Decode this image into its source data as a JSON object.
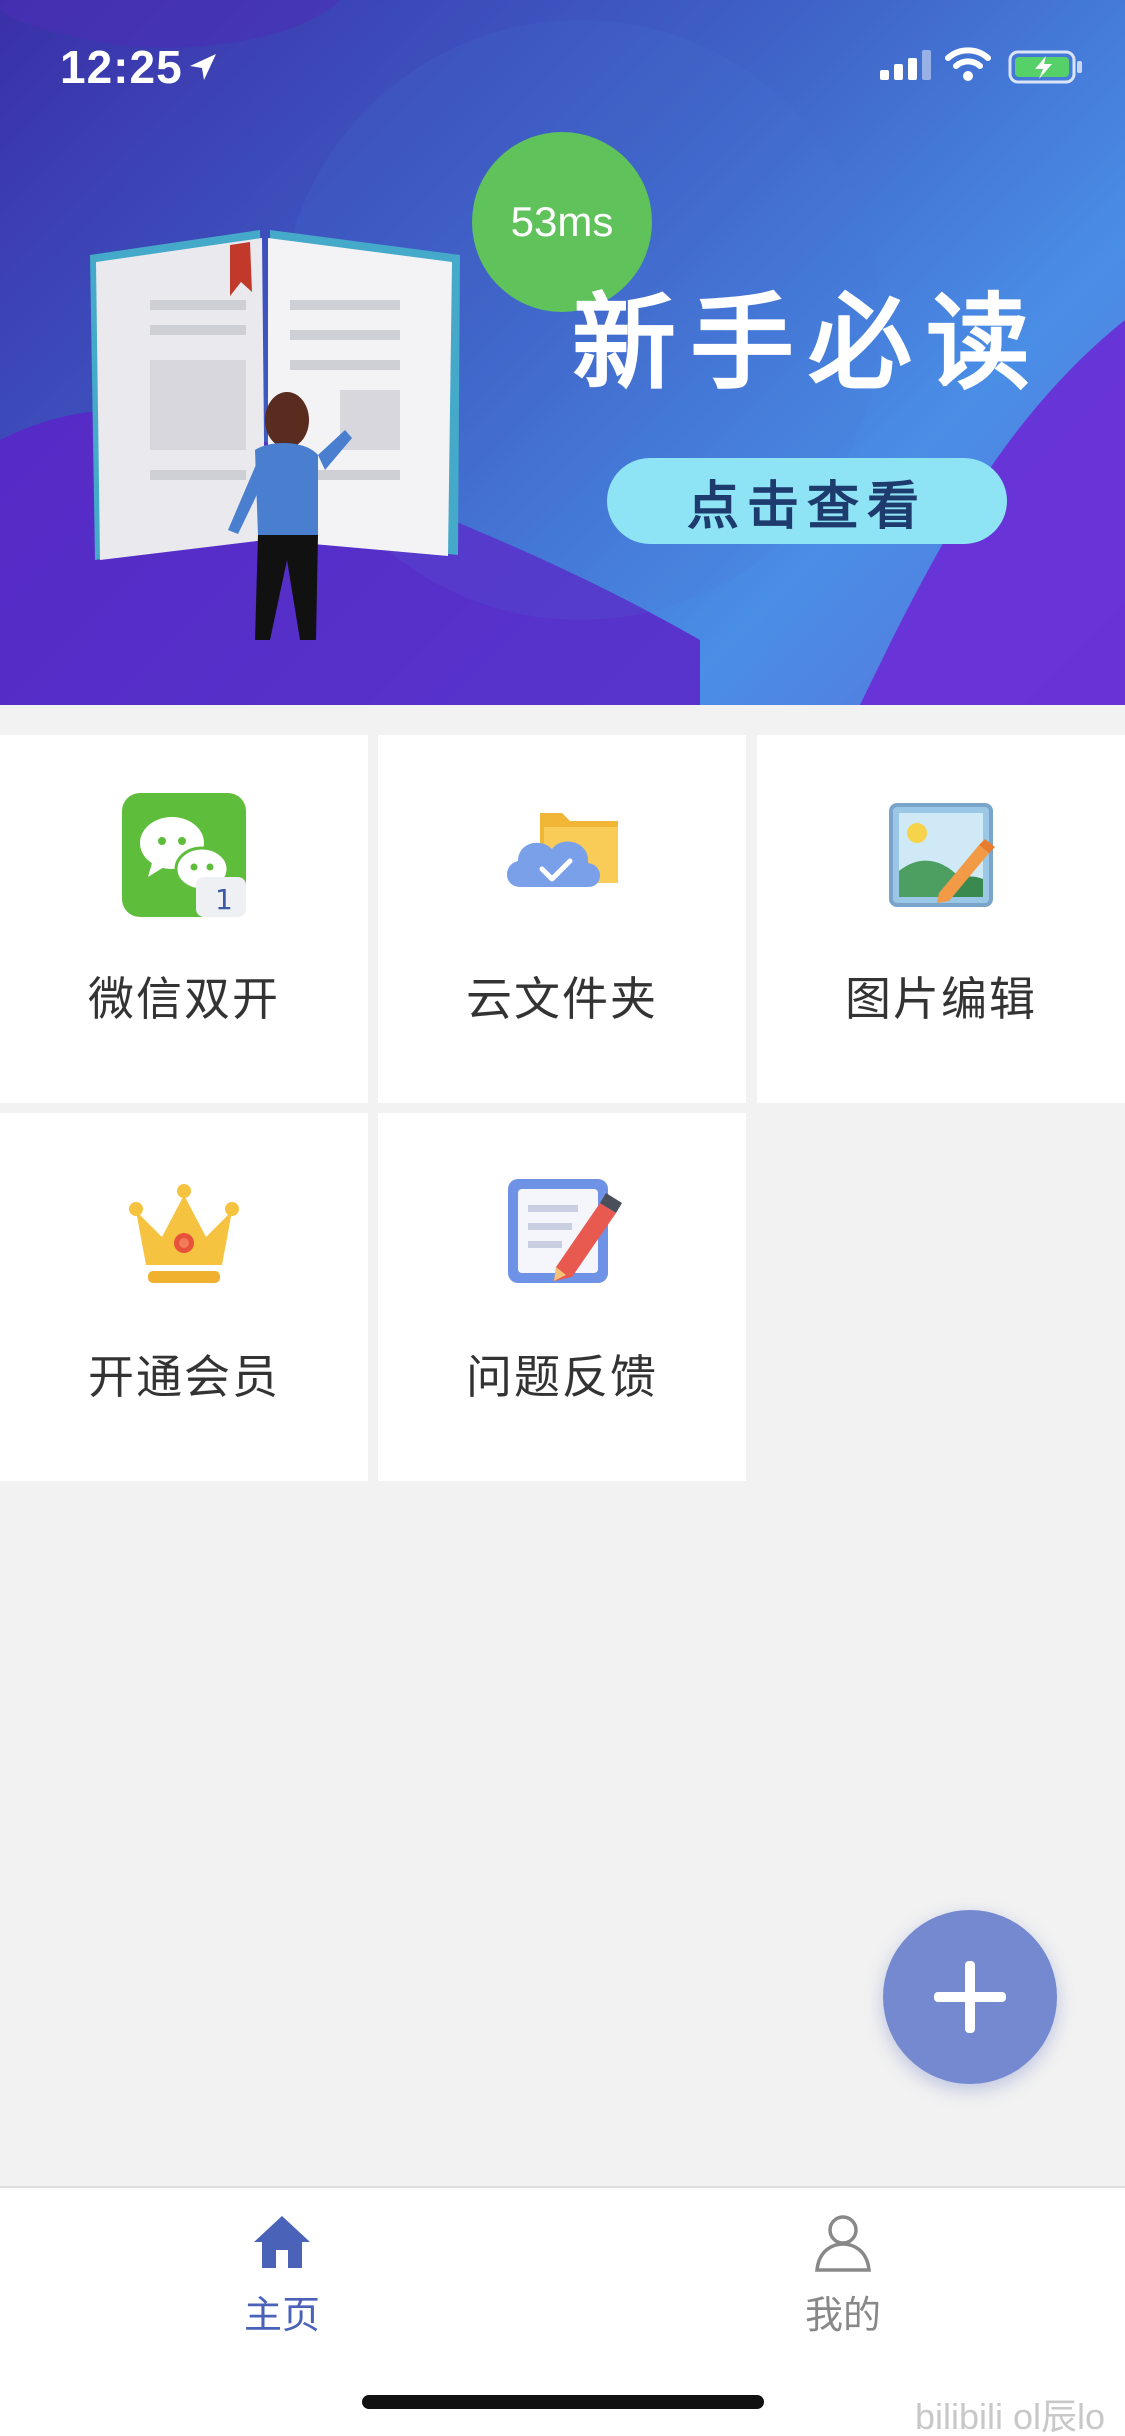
{
  "status_bar": {
    "time": "12:25",
    "icons": [
      "location-arrow-icon",
      "signal-icon",
      "wifi-icon",
      "battery-charging-icon"
    ]
  },
  "banner": {
    "latency": "53ms",
    "title": "新手必读",
    "button_label": "点击查看",
    "colors": {
      "bg_start": "#3a2fa8",
      "bg_end": "#4a8ee6",
      "button": "#8ee3f5",
      "latency_badge": "#5fc25b"
    }
  },
  "grid": {
    "items": [
      {
        "label": "微信双开",
        "icon": "wechat-icon",
        "badge": "1"
      },
      {
        "label": "云文件夹",
        "icon": "cloud-folder-icon"
      },
      {
        "label": "图片编辑",
        "icon": "image-edit-icon"
      },
      {
        "label": "开通会员",
        "icon": "crown-icon"
      },
      {
        "label": "问题反馈",
        "icon": "feedback-edit-icon"
      }
    ]
  },
  "fab": {
    "icon": "plus-icon",
    "color": "#7489d0"
  },
  "bottom_nav": {
    "items": [
      {
        "label": "主页",
        "icon": "home-icon",
        "active": true,
        "color": "#4a63b8"
      },
      {
        "label": "我的",
        "icon": "user-icon",
        "active": false,
        "color": "#888888"
      }
    ]
  },
  "watermark": "bilibili ol辰lo"
}
